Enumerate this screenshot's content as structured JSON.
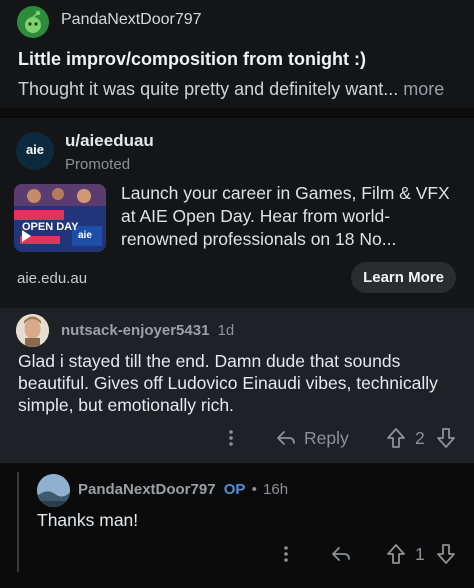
{
  "post": {
    "author": "PandaNextDoor797",
    "title": "Little improv/composition from tonight :)",
    "preview": "Thought it was quite pretty and definitely want...",
    "more_label": "more"
  },
  "ad": {
    "author": "u/aieeduau",
    "promoted_label": "Promoted",
    "logo_text": "aie",
    "thumb_open_day": "OPEN DAY",
    "thumb_logo": "aie",
    "text": "Launch your career in Games, Film & VFX at AIE Open Day. Hear from world-renowned professionals on 18 No...",
    "domain": "aie.edu.au",
    "cta_label": "Learn More"
  },
  "comment1": {
    "author": "nutsack-enjoyer5431",
    "time": "1d",
    "body": "Glad i stayed till the end. Damn dude that sounds beautiful. Gives off Ludovico Einaudi vibes, technically simple, but emotionally rich.",
    "reply_label": "Reply",
    "score": "2"
  },
  "comment2": {
    "author": "PandaNextDoor797",
    "op_label": "OP",
    "separator": "•",
    "time": "16h",
    "body": "Thanks man!",
    "score": "1"
  },
  "colors": {
    "background": "#0b0b0c",
    "comment_bg": "#1e2226",
    "op_blue": "#4f8fd6",
    "cta_bg": "#2a2c2e"
  }
}
